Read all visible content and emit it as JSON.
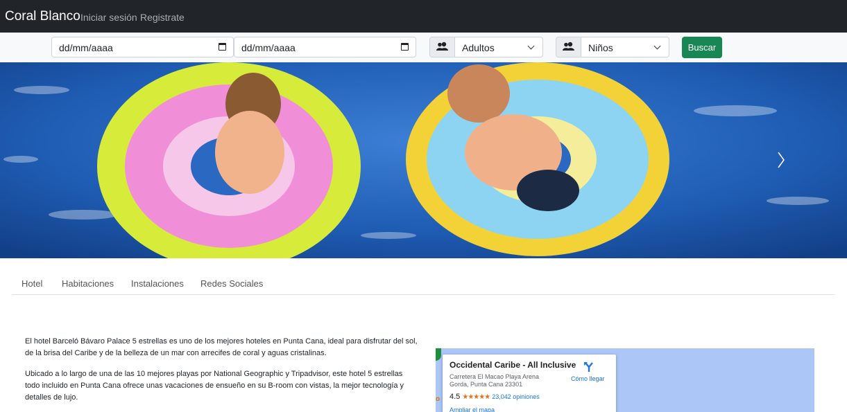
{
  "navbar": {
    "brand": "Coral Blanco",
    "links": [
      "Iniciar sesión",
      "Registrate"
    ]
  },
  "search": {
    "checkin_placeholder": "dd/mm/aaaa",
    "checkout_placeholder": "dd/mm/aaaa",
    "adults_selected": "Adultos",
    "children_selected": "Niños",
    "submit_label": "Buscar",
    "icons": [
      "calendar-icon",
      "people-icon",
      "chevron-down-icon"
    ]
  },
  "hero": {
    "carousel_next": "chevron-right-icon"
  },
  "tabs": [
    "Hotel",
    "Habitaciones",
    "Instalaciones",
    "Redes Sociales"
  ],
  "content": {
    "paragraphs": [
      "El hotel Barceló Bávaro Palace 5 estrellas es uno de los mejores hoteles en Punta Cana, ideal para disfrutar del sol, de la brisa del Caribe y de la belleza de un mar con arrecifes de coral y aguas cristalinas.",
      "Ubicado a lo largo de una de las 10 mejores playas por National Geographic y Tripadvisor, este hotel 5 estrellas todo incluido en Punta Cana ofrece unas vacaciones de ensueño en su B-room con vistas, la mejor tecnología y detalles de lujo."
    ]
  },
  "map": {
    "place_name": "Occidental Caribe - All Inclusive",
    "address": "Carretera El Macao Playa Arena Gorda, Punta Cana 23301",
    "rating": "4.5",
    "stars": "★★★★★",
    "reviews": "23,042 opiniones",
    "directions_label": "Cómo llegar",
    "enlarge_label": "Ampliar el mapa",
    "edge_letter": "o"
  },
  "colors": {
    "navbar": "#212529",
    "button": "#198754",
    "map_water": "#abc6f7",
    "link": "#1a73e8"
  }
}
